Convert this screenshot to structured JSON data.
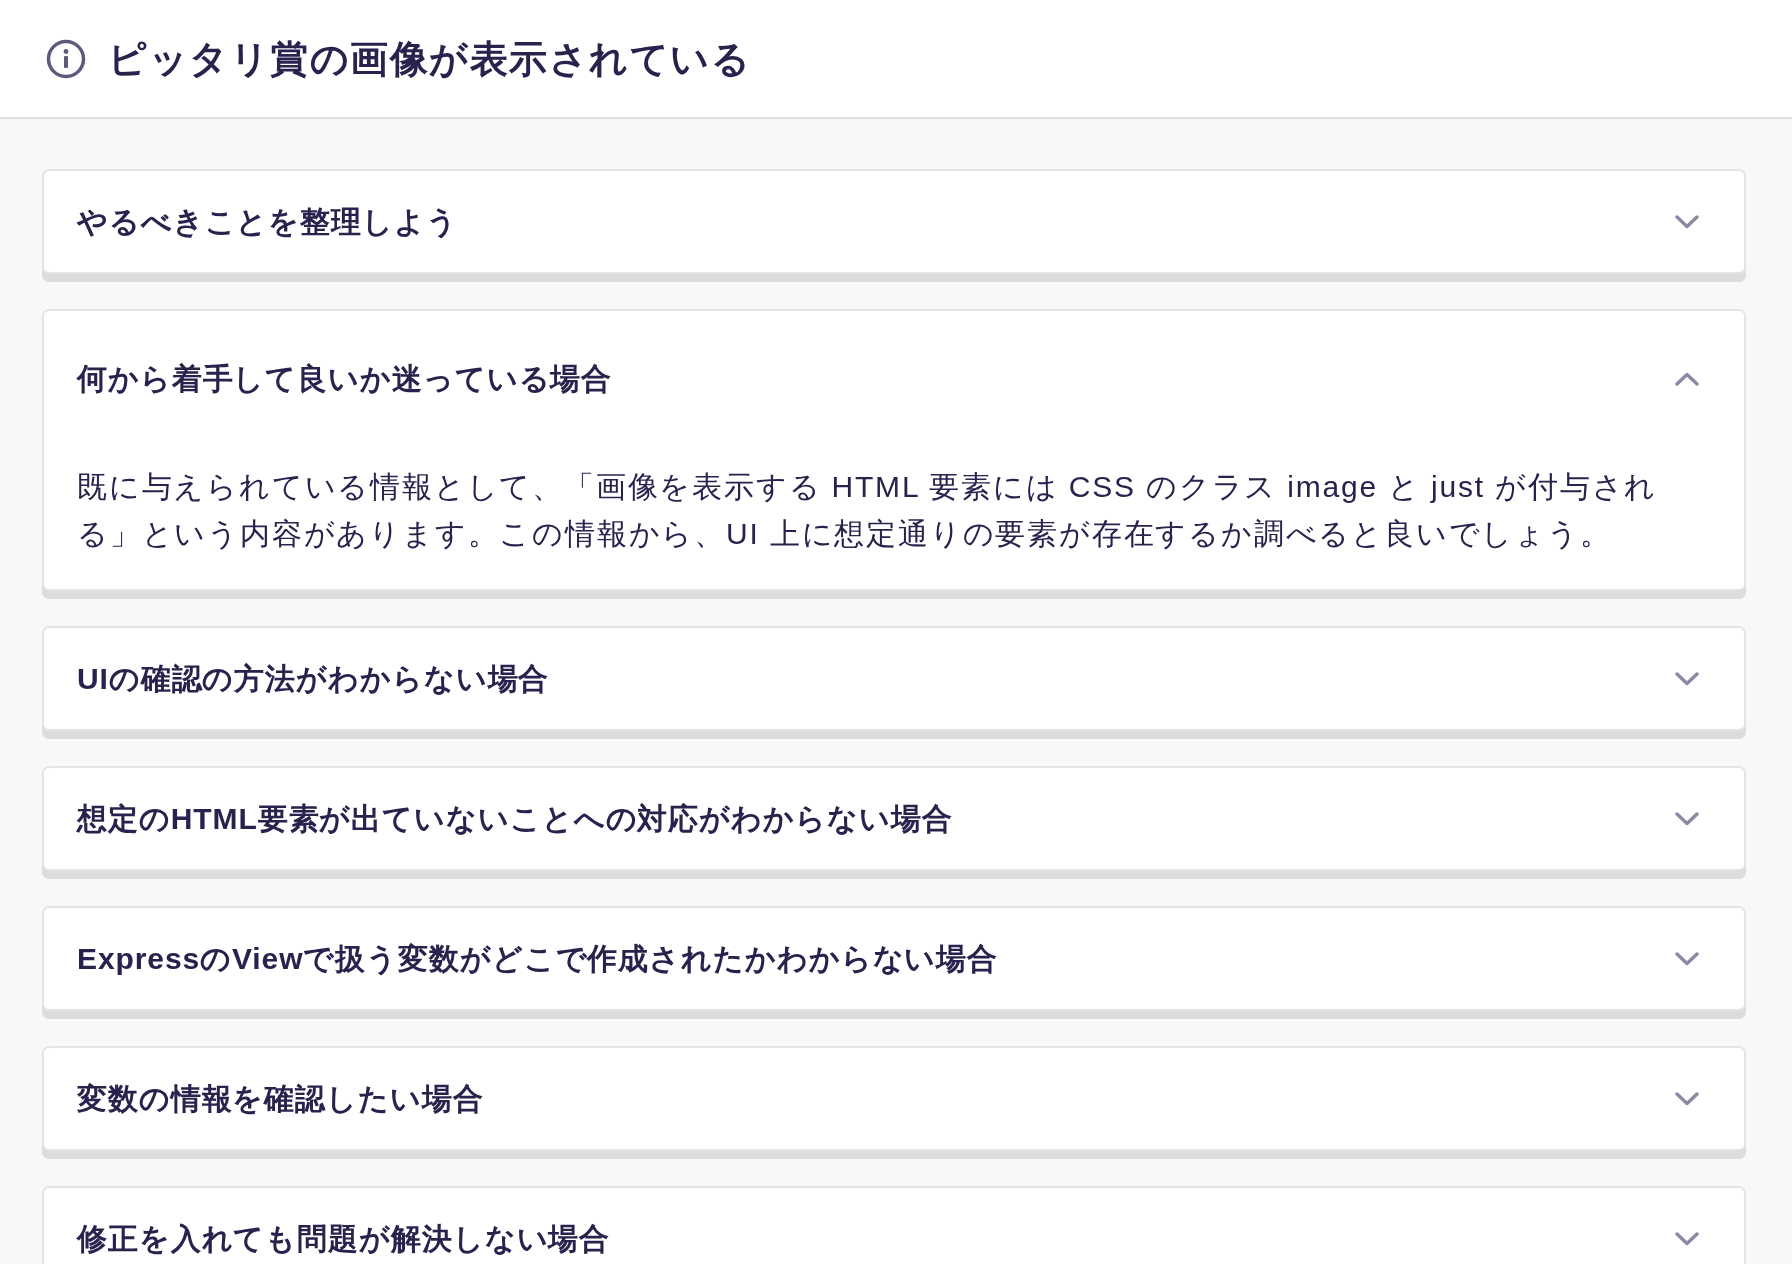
{
  "header": {
    "title": "ピッタリ賞の画像が表示されている"
  },
  "accordion": [
    {
      "title": "やるべきことを整理しよう",
      "expanded": false
    },
    {
      "title": "何から着手して良いか迷っている場合",
      "expanded": true,
      "body": "既に与えられている情報として、「画像を表示する HTML 要素には CSS のクラス image と just が付与される」という内容があります。この情報から、UI 上に想定通りの要素が存在するか調べると良いでしょう。"
    },
    {
      "title": "UIの確認の方法がわからない場合",
      "expanded": false
    },
    {
      "title": "想定のHTML要素が出ていないことへの対応がわからない場合",
      "expanded": false
    },
    {
      "title": "ExpressのViewで扱う変数がどこで作成されたかわからない場合",
      "expanded": false
    },
    {
      "title": "変数の情報を確認したい場合",
      "expanded": false
    },
    {
      "title": "修正を入れても問題が解決しない場合",
      "expanded": false
    }
  ]
}
